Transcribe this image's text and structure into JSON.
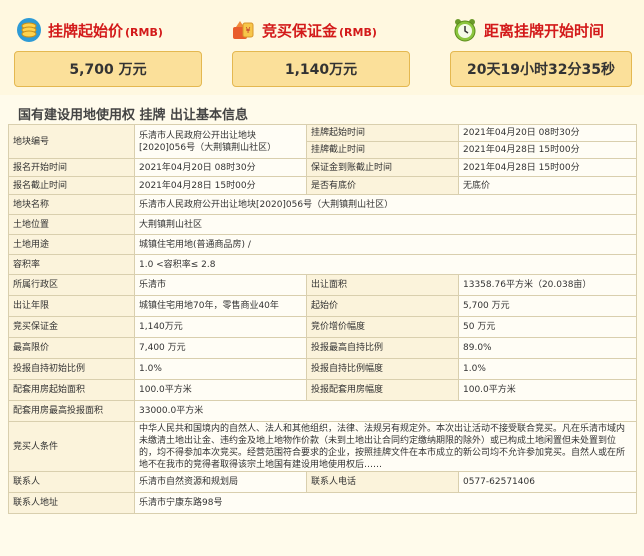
{
  "header": {
    "start_price": {
      "title": "挂牌起始价",
      "unit": "(RMB)",
      "value": "5,700 万元",
      "icon": "coin-stack-icon"
    },
    "deposit": {
      "title": "竞买保证金",
      "unit": "(RMB)",
      "value": "1,140万元",
      "icon": "money-bag-icon"
    },
    "countdown": {
      "title": "距离挂牌开始时间",
      "value": "20天19小时32分35秒",
      "icon": "alarm-clock-icon"
    }
  },
  "section_title": "国有建设用地使用权 挂牌 出让基本信息",
  "table": {
    "r1": {
      "l1": "地块编号",
      "v1": "乐清市人民政府公开出让地块[2020]056号（大荆镇荆山社区）",
      "l2a": "挂牌起始时间",
      "v2a": "2021年04月20日 08时30分",
      "l2b": "挂牌截止时间",
      "v2b": "2021年04月28日 15时00分"
    },
    "r2": {
      "l1": "报名开始时间",
      "v1": "2021年04月20日 08时30分",
      "l2": "保证金到账截止时间",
      "v2": "2021年04月28日 15时00分"
    },
    "r3": {
      "l1": "报名截止时间",
      "v1": "2021年04月28日 15时00分",
      "l2": "是否有底价",
      "v2": "无底价"
    },
    "r4": {
      "l1": "地块名称",
      "v1": "乐清市人民政府公开出让地块[2020]056号（大荆镇荆山社区）"
    },
    "r5": {
      "l1": "土地位置",
      "v1": "大荆镇荆山社区"
    },
    "r6": {
      "l1": "土地用途",
      "v1": "城镇住宅用地(普通商品房) /"
    },
    "r7": {
      "l1": "容积率",
      "v1": "1.0 <容积率≤ 2.8"
    },
    "r8": {
      "l1": "所属行政区",
      "v1": "乐清市",
      "l2": "出让面积",
      "v2": "13358.76平方米（20.038亩）"
    },
    "r9": {
      "l1": "出让年限",
      "v1": "城镇住宅用地70年，零售商业40年",
      "l2": "起始价",
      "v2": "5,700 万元"
    },
    "r10": {
      "l1": "竞买保证金",
      "v1": "1,140万元",
      "l2": "竞价增价幅度",
      "v2": "50 万元"
    },
    "r11": {
      "l1": "最高限价",
      "v1": "7,400 万元",
      "l2": "投报最高自持比例",
      "v2": "89.0%"
    },
    "r12": {
      "l1": "投报自持初始比例",
      "v1": "1.0%",
      "l2": "投报自持比例幅度",
      "v2": "1.0%"
    },
    "r13": {
      "l1": "配套用房起始面积",
      "v1": "100.0平方米",
      "l2": "投报配套用房幅度",
      "v2": "100.0平方米"
    },
    "r14": {
      "l1": "配套用房最高投报面积",
      "v1": "33000.0平方米"
    },
    "r15": {
      "l1": "竞买人条件",
      "v1": "中华人民共和国境内的自然人、法人和其他组织，法律、法规另有规定外。本次出让活动不接受联合竞买。凡在乐清市域内未缴清土地出让金、违约金及地上地物作价款（未到土地出让合同约定缴纳期限的除外）或已构成土地闲置但未处置到位的，均不得参加本次竞买。经营范围符合要求的企业，按照挂牌文件在本市成立的新公司均不允许参加竞买。自然人或在所地不在我市的竞得者取得该宗土地国有建设用地使用权后……"
    },
    "r16": {
      "l1": "联系人",
      "v1": "乐清市自然资源和规划局",
      "l2": "联系人电话",
      "v2": "0577-62571406"
    },
    "r17": {
      "l1": "联系人地址",
      "v1": "乐清市宁康东路98号"
    }
  }
}
